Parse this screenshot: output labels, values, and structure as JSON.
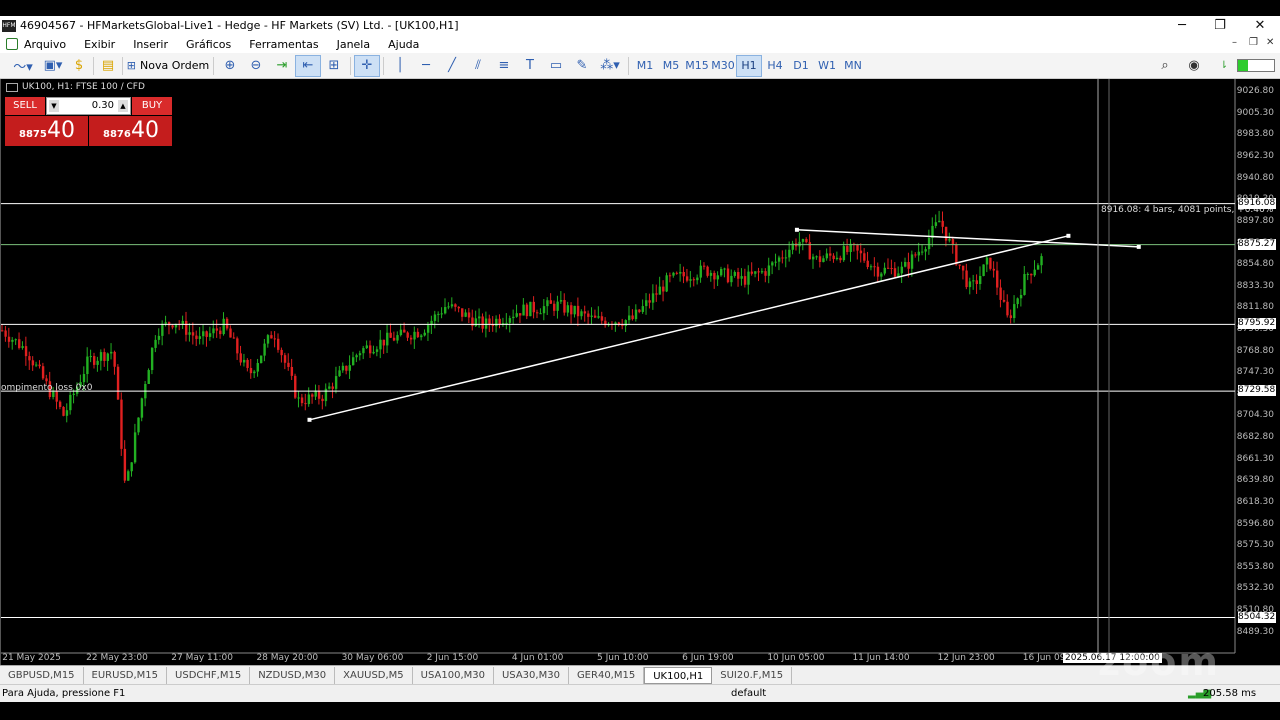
{
  "window": {
    "title": "46904567 - HFMarketsGlobal-Live1 - Hedge - HF Markets (SV) Ltd. - [UK100,H1]",
    "minimize": "─",
    "restore": "❐",
    "close": "✕"
  },
  "menu": {
    "items": [
      "Arquivo",
      "Exibir",
      "Inserir",
      "Gráficos",
      "Ferramentas",
      "Janela",
      "Ajuda"
    ],
    "child_controls": [
      "–",
      "❐",
      "✕"
    ]
  },
  "toolbar": {
    "new_order_label": "Nova Ordem",
    "timeframes": [
      "M1",
      "M5",
      "M15",
      "M30",
      "H1",
      "H4",
      "D1",
      "W1",
      "MN"
    ],
    "selected_timeframe": "H1"
  },
  "chart": {
    "label": "UK100, H1:  FTSE 100 / CFD",
    "trade_panel": {
      "sell_label": "SELL",
      "buy_label": "BUY",
      "lot": "0.30",
      "bid_small": "8875",
      "bid_large": "40",
      "ask_small": "8876",
      "ask_large": "40"
    },
    "measure_label": "8916.08: 4 bars, 4081 points, +0.46%",
    "left_annotation": "ompimento loss 0x0",
    "cursor_time": "2025.06.17 12:00:00"
  },
  "chart_data": {
    "type": "candlestick",
    "symbol": "UK100",
    "timeframe": "H1",
    "y_ticks": [
      "9026.80",
      "9005.30",
      "8983.80",
      "8962.30",
      "8940.80",
      "8919.30",
      "8897.80",
      "8876.30",
      "8854.80",
      "8833.30",
      "8811.80",
      "8790.30",
      "8768.80",
      "8747.30",
      "8725.80",
      "8704.30",
      "8682.80",
      "8661.30",
      "8639.80",
      "8618.30",
      "8596.80",
      "8575.30",
      "8553.80",
      "8532.30",
      "8510.80",
      "8489.30"
    ],
    "ylim": [
      8475,
      9040
    ],
    "x_ticks": [
      "21 May 2025",
      "22 May 23:00",
      "27 May 11:00",
      "28 May 20:00",
      "30 May 06:00",
      "2 Jun 15:00",
      "4 Jun 01:00",
      "5 Jun 10:00",
      "6 Jun 19:00",
      "10 Jun 05:00",
      "11 Jun 14:00",
      "12 Jun 23:00",
      "16 Jun 09:00"
    ],
    "horizontal_levels": [
      8916.08,
      8875.27,
      8795.92,
      8729.58,
      8504.32
    ],
    "level_labels": [
      "8916.08",
      "8875.27",
      "8795.92",
      "8729.58",
      "8504.32"
    ],
    "trendlines": [
      {
        "from": {
          "t": 0.25,
          "p": 8701
        },
        "to": {
          "t": 0.865,
          "p": 8884
        }
      },
      {
        "from": {
          "t": 0.645,
          "p": 8890
        },
        "to": {
          "t": 0.922,
          "p": 8873
        }
      }
    ],
    "price_path": [
      {
        "t": 0.0,
        "p": 8790
      },
      {
        "t": 0.02,
        "p": 8770
      },
      {
        "t": 0.05,
        "p": 8705
      },
      {
        "t": 0.07,
        "p": 8760
      },
      {
        "t": 0.09,
        "p": 8770
      },
      {
        "t": 0.1,
        "p": 8630
      },
      {
        "t": 0.115,
        "p": 8735
      },
      {
        "t": 0.125,
        "p": 8790
      },
      {
        "t": 0.14,
        "p": 8800
      },
      {
        "t": 0.16,
        "p": 8780
      },
      {
        "t": 0.18,
        "p": 8795
      },
      {
        "t": 0.2,
        "p": 8745
      },
      {
        "t": 0.22,
        "p": 8790
      },
      {
        "t": 0.24,
        "p": 8720
      },
      {
        "t": 0.26,
        "p": 8725
      },
      {
        "t": 0.29,
        "p": 8770
      },
      {
        "t": 0.31,
        "p": 8780
      },
      {
        "t": 0.34,
        "p": 8790
      },
      {
        "t": 0.36,
        "p": 8815
      },
      {
        "t": 0.39,
        "p": 8795
      },
      {
        "t": 0.42,
        "p": 8810
      },
      {
        "t": 0.45,
        "p": 8815
      },
      {
        "t": 0.48,
        "p": 8800
      },
      {
        "t": 0.51,
        "p": 8800
      },
      {
        "t": 0.54,
        "p": 8840
      },
      {
        "t": 0.57,
        "p": 8850
      },
      {
        "t": 0.6,
        "p": 8840
      },
      {
        "t": 0.62,
        "p": 8850
      },
      {
        "t": 0.645,
        "p": 8880
      },
      {
        "t": 0.66,
        "p": 8860
      },
      {
        "t": 0.69,
        "p": 8870
      },
      {
        "t": 0.71,
        "p": 8850
      },
      {
        "t": 0.73,
        "p": 8850
      },
      {
        "t": 0.75,
        "p": 8880
      },
      {
        "t": 0.76,
        "p": 8900
      },
      {
        "t": 0.77,
        "p": 8870
      },
      {
        "t": 0.785,
        "p": 8830
      },
      {
        "t": 0.8,
        "p": 8860
      },
      {
        "t": 0.815,
        "p": 8800
      },
      {
        "t": 0.83,
        "p": 8845
      },
      {
        "t": 0.845,
        "p": 8865
      }
    ]
  },
  "tabs": {
    "items": [
      "GBPUSD,M15",
      "EURUSD,M15",
      "USDCHF,M15",
      "NZDUSD,M30",
      "XAUUSD,M5",
      "USA100,M30",
      "USA30,M30",
      "GER40,M15",
      "UK100,H1",
      "SUI20.F,M15"
    ],
    "selected": "UK100,H1"
  },
  "status": {
    "help": "Para Ajuda, pressione F1",
    "profile": "default",
    "ping": "205.58 ms"
  },
  "watermark": "zoom",
  "colors": {
    "bull": "#22b022",
    "bear": "#e02020",
    "sell_bg": "#d92b2b",
    "level_line": "#ffffff",
    "green_level": "#7cc07c"
  }
}
